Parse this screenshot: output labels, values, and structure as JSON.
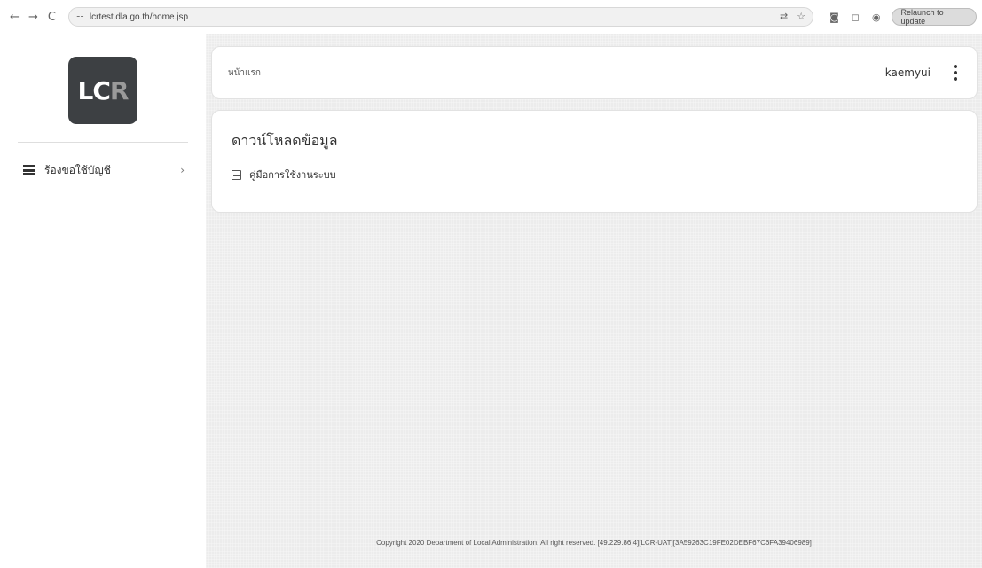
{
  "browser": {
    "url": "lcrtest.dla.go.th/home.jsp",
    "relaunch_label": "Relaunch to update",
    "back": "←",
    "forward": "→",
    "reload": "C",
    "site_info": "⚍"
  },
  "sidebar": {
    "logo_text_main": "LC",
    "logo_text_accent": "R",
    "items": [
      {
        "label": "ร้องขอใช้บัญชี",
        "icon": "list-icon",
        "chevron": "›"
      }
    ]
  },
  "header": {
    "breadcrumb": "หน้าแรก",
    "username": "kaemyui"
  },
  "download_card": {
    "title": "ดาวน์โหลดข้อมูล",
    "items": [
      {
        "label": "คู่มือการใช้งานระบบ",
        "icon": "document-icon"
      }
    ]
  },
  "footer": {
    "text": "Copyright 2020 Department of Local Administration. All right reserved. [49.229.86.4][LCR-UAT][3A59263C19FE02DEBF67C6FA39406989]"
  }
}
